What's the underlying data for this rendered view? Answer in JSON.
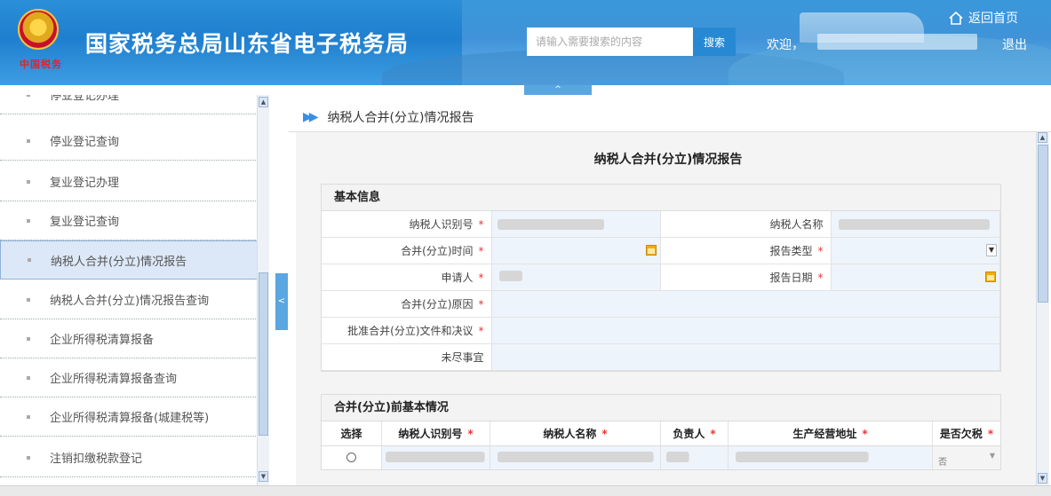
{
  "header": {
    "title": "国家税务总局山东省电子税务局",
    "emblem_tag": "中国税务",
    "search_placeholder": "请输入需要搜索的内容",
    "search_button": "搜索",
    "welcome": "欢迎，",
    "logout": "退出",
    "home": "返回首页"
  },
  "collapse_tab": "^",
  "sidebar": {
    "items": [
      {
        "label": "停业登记办理"
      },
      {
        "label": "停业登记查询"
      },
      {
        "label": "复业登记办理"
      },
      {
        "label": "复业登记查询"
      },
      {
        "label": "纳税人合并(分立)情况报告"
      },
      {
        "label": "纳税人合并(分立)情况报告查询"
      },
      {
        "label": "企业所得税清算报备"
      },
      {
        "label": "企业所得税清算报备查询"
      },
      {
        "label": "企业所得税清算报备(城建税等)"
      },
      {
        "label": "注销扣缴税款登记"
      }
    ],
    "active_index": 4,
    "toggle": "<"
  },
  "breadcrumb": {
    "arrow": "▶▶",
    "current": "纳税人合并(分立)情况报告"
  },
  "form": {
    "title": "纳税人合并(分立)情况报告",
    "basic": {
      "heading": "基本信息",
      "taxpayer_id_label": "纳税人识别号",
      "taxpayer_name_label": "纳税人名称",
      "merge_time_label": "合并(分立)时间",
      "report_type_label": "报告类型",
      "applicant_label": "申请人",
      "report_date_label": "报告日期",
      "reason_label": "合并(分立)原因",
      "approval_doc_label": "批准合并(分立)文件和决议",
      "pending_label": "未尽事宜",
      "required_mark": "*"
    },
    "before": {
      "heading": "合并(分立)前基本情况",
      "columns": [
        "选择",
        "纳税人识别号",
        "纳税人名称",
        "负责人",
        "生产经营地址",
        "是否欠税"
      ],
      "required_cols": [
        false,
        true,
        true,
        true,
        true,
        true
      ],
      "row_arrears_value": "否"
    }
  },
  "colors": {
    "header_blue": "#1f7fcf",
    "accent": "#3a8ee6",
    "required": "#e33",
    "input_bg": "#eef4fb"
  }
}
